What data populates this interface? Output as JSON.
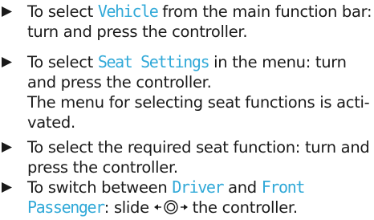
{
  "steps": [
    {
      "line1_pre": "To select ",
      "term": "Vehicle",
      "line1_post": " from the main function bar:",
      "line2": "turn and press the controller."
    },
    {
      "line1_pre": "To select ",
      "term": "Seat Settings",
      "line1_post": " in the menu: turn",
      "line2": "and press the controller.",
      "result_line1": "The menu for selecting seat functions is acti-",
      "result_line2": "vated."
    },
    {
      "line1": "To select the required seat function: turn and",
      "line2": "press the controller."
    },
    {
      "line1_pre": "To switch between ",
      "term1": "Driver",
      "line1_mid": " and ",
      "term2_part1": "Front",
      "term2_part2": "Passenger",
      "line2_mid": ": slide ",
      "line2_post": " the controller."
    }
  ],
  "icons": {
    "bullet": "triangle-right-icon",
    "controller": "controller-slide-left-right-icon"
  },
  "colors": {
    "highlight": "#31a9d8",
    "text": "#1a1a1a"
  }
}
